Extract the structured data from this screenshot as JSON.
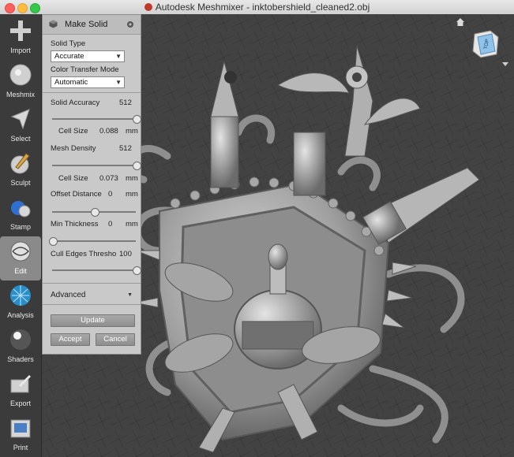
{
  "window": {
    "title": "Autodesk Meshmixer - inktobershield_cleaned2.obj"
  },
  "toolbar": {
    "items": [
      {
        "label": "Import",
        "icon": "import-plus-icon"
      },
      {
        "label": "Meshmix",
        "icon": "meshmix-icon"
      },
      {
        "label": "Select",
        "icon": "select-arrow-icon"
      },
      {
        "label": "Sculpt",
        "icon": "sculpt-brush-icon"
      },
      {
        "label": "Stamp",
        "icon": "stamp-icon"
      },
      {
        "label": "Edit",
        "icon": "edit-icon",
        "active": true
      },
      {
        "label": "Analysis",
        "icon": "analysis-icon"
      },
      {
        "label": "Shaders",
        "icon": "shaders-icon"
      },
      {
        "label": "Export",
        "icon": "export-icon"
      },
      {
        "label": "Print",
        "icon": "print-icon"
      }
    ]
  },
  "panel": {
    "title": "Make Solid",
    "solid_type_label": "Solid Type",
    "solid_type_value": "Accurate",
    "color_transfer_label": "Color Transfer Mode",
    "color_transfer_value": "Automatic",
    "solid_accuracy": {
      "label": "Solid Accuracy",
      "value": "512",
      "slider_fraction": 1.0
    },
    "cell_size_1": {
      "label": "Cell Size",
      "value": "0.088",
      "unit": "mm"
    },
    "mesh_density": {
      "label": "Mesh Density",
      "value": "512",
      "slider_fraction": 1.0
    },
    "cell_size_2": {
      "label": "Cell Size",
      "value": "0.073",
      "unit": "mm"
    },
    "offset_distance": {
      "label": "Offset Distance",
      "value": "0",
      "unit": "mm",
      "slider_fraction": 0.5
    },
    "min_thickness": {
      "label": "Min Thickness",
      "value": "0",
      "unit": "mm",
      "slider_fraction": 0.0
    },
    "cull_edges": {
      "label": "Cull Edges Thresho",
      "value": "100",
      "slider_fraction": 1.0
    },
    "advanced_label": "Advanced",
    "update_label": "Update",
    "accept_label": "Accept",
    "cancel_label": "Cancel"
  },
  "viewcube": {
    "face_label": "TOP"
  },
  "colors": {
    "panel_bg": "#c9c9c9",
    "viewport_bg": "#424242",
    "viewcube_face": "#8fc3ea",
    "model": "#9c9c9c"
  }
}
